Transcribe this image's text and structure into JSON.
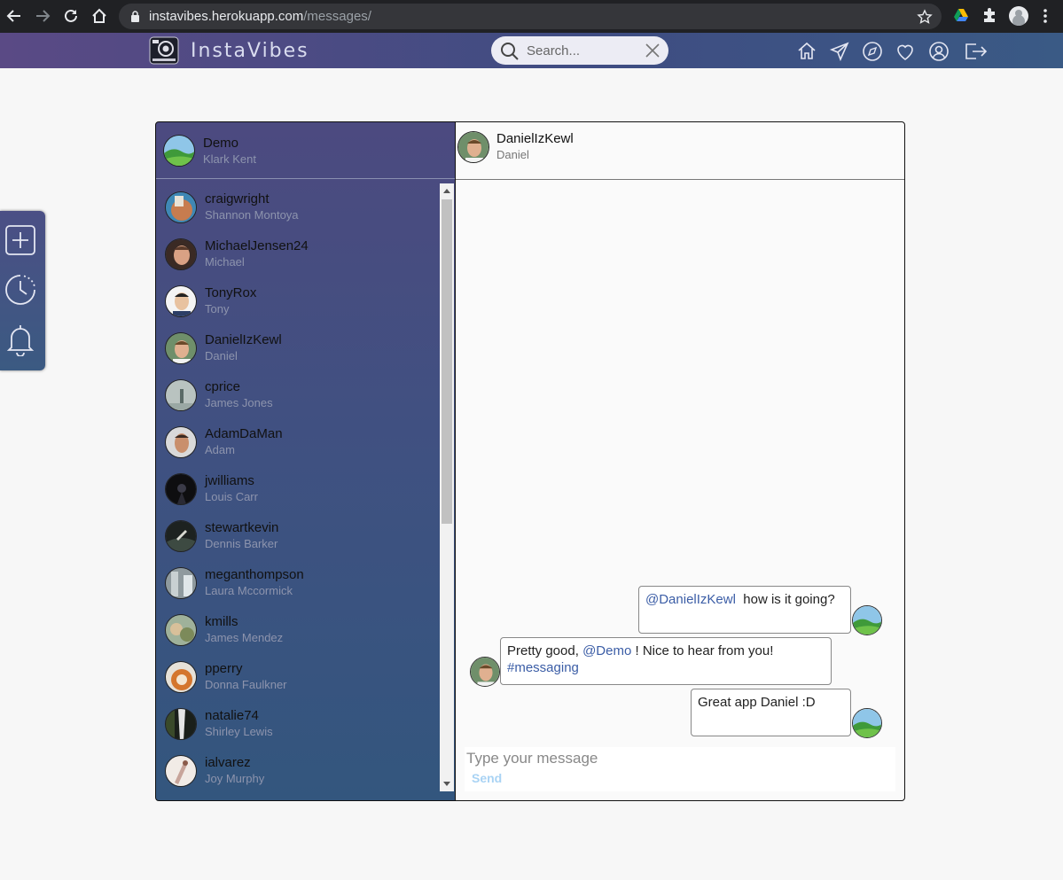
{
  "browser": {
    "url_host": "instavibes.herokuapp.com",
    "url_path": "/messages/"
  },
  "header": {
    "brand": "InstaVibes",
    "search_placeholder": "Search...",
    "nav_icons": [
      "home-icon",
      "send-icon",
      "explore-icon",
      "heart-icon",
      "profile-icon",
      "logout-icon"
    ]
  },
  "side_tools": [
    "plus-icon",
    "clock-icon",
    "bell-icon"
  ],
  "current_user": {
    "username": "Demo",
    "name": "Klark Kent"
  },
  "conversations": [
    {
      "username": "craigwright",
      "name": "Shannon Montoya"
    },
    {
      "username": "MichaelJensen24",
      "name": "Michael"
    },
    {
      "username": "TonyRox",
      "name": "Tony"
    },
    {
      "username": "DanielIzKewl",
      "name": "Daniel"
    },
    {
      "username": "cprice",
      "name": "James Jones"
    },
    {
      "username": "AdamDaMan",
      "name": "Adam"
    },
    {
      "username": "jwilliams",
      "name": "Louis Carr"
    },
    {
      "username": "stewartkevin",
      "name": "Dennis Barker"
    },
    {
      "username": "meganthompson",
      "name": "Laura Mccormick"
    },
    {
      "username": "kmills",
      "name": "James Mendez"
    },
    {
      "username": "pperry",
      "name": "Donna Faulkner"
    },
    {
      "username": "natalie74",
      "name": "Shirley Lewis"
    },
    {
      "username": "ialvarez",
      "name": "Joy Murphy"
    }
  ],
  "chat": {
    "username": "DanielIzKewl",
    "name": "Daniel",
    "messages": [
      {
        "mention": "@DanielIzKewl",
        "text_after": "  how is it going?"
      },
      {
        "text_before": "Pretty good, ",
        "mention": "@Demo",
        "text_after": " ! Nice to hear from you!",
        "hashtag": "#messaging"
      },
      {
        "text": "Great app Daniel :D"
      }
    ],
    "input_placeholder": "Type your message",
    "send_label": "Send"
  }
}
